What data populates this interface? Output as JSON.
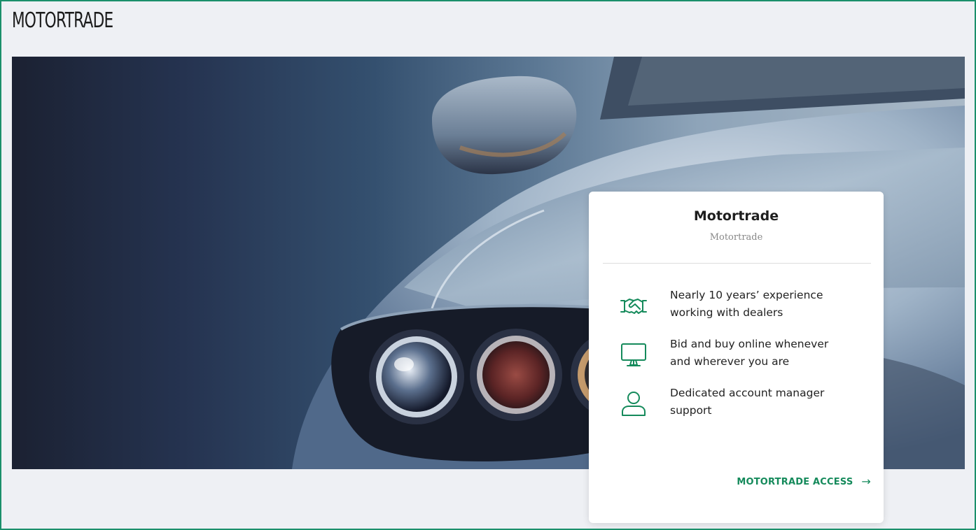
{
  "page": {
    "title": "MOTORTRADE"
  },
  "hero": {
    "image": "car-headlight-photo"
  },
  "card": {
    "title": "Motortrade",
    "subtitle": "Motortrade",
    "features": [
      {
        "icon": "handshake-icon",
        "text": "Nearly 10 years’ experience working with dealers"
      },
      {
        "icon": "monitor-icon",
        "text": "Bid and buy online whenever and wherever you are"
      },
      {
        "icon": "person-icon",
        "text": "Dedicated account manager support"
      }
    ],
    "link_label": "MOTORTRADE ACCESS",
    "link_arrow": "→"
  },
  "colors": {
    "accent": "#158a5b",
    "frame": "#1a8f6a",
    "background": "#eef0f4"
  }
}
